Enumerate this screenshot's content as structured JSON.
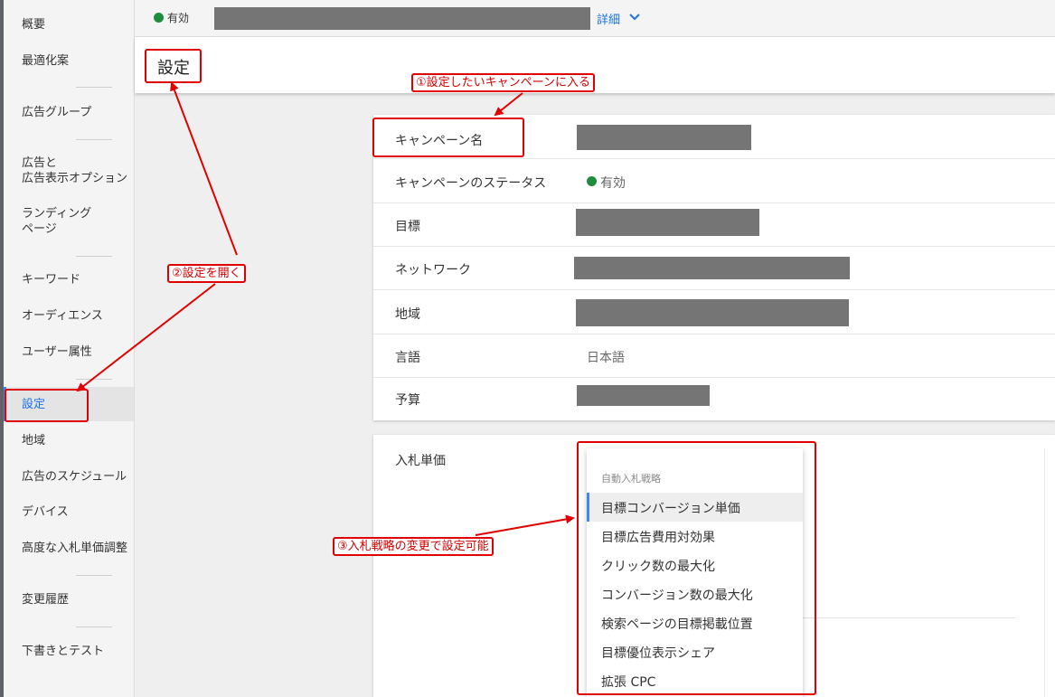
{
  "sidebar": {
    "items": [
      {
        "label": "概要"
      },
      {
        "label": "最適化案"
      },
      {
        "label": "広告グループ"
      },
      {
        "label": "広告と\n広告表示オプション"
      },
      {
        "label": "ランディング\nページ"
      },
      {
        "label": "キーワード"
      },
      {
        "label": "オーディエンス"
      },
      {
        "label": "ユーザー属性"
      },
      {
        "label": "設定"
      },
      {
        "label": "地域"
      },
      {
        "label": "広告のスケジュール"
      },
      {
        "label": "デバイス"
      },
      {
        "label": "高度な入札単価調整"
      },
      {
        "label": "変更履歴"
      },
      {
        "label": "下書きとテスト"
      }
    ],
    "active": "設定"
  },
  "topbar": {
    "status": "有効",
    "details": "詳細"
  },
  "page": {
    "title": "設定"
  },
  "campaign_settings": {
    "rows": [
      {
        "label": "キャンペーン名"
      },
      {
        "label": "キャンペーンのステータス",
        "value": "有効"
      },
      {
        "label": "目標"
      },
      {
        "label": "ネットワーク"
      },
      {
        "label": "地域"
      },
      {
        "label": "言語",
        "value": "日本語"
      },
      {
        "label": "予算"
      }
    ]
  },
  "bidding": {
    "label": "入札単価",
    "dropdown": {
      "header": "自動入札戦略",
      "options": [
        {
          "label": "目標コンバージョン単価",
          "selected": true
        },
        {
          "label": "目標広告費用対効果"
        },
        {
          "label": "クリック数の最大化"
        },
        {
          "label": "コンバージョン数の最大化"
        },
        {
          "label": "検索ページの目標掲載位置"
        },
        {
          "label": "目標優位表示シェア"
        },
        {
          "label": "拡張 CPC"
        }
      ]
    }
  },
  "annotations": {
    "step1": "①設定したいキャンペーンに入る",
    "step2": "②設定を開く",
    "step3": "③入札戦略の変更で設定可能",
    "color": "#e00000"
  },
  "colors": {
    "accent": "#4285f4",
    "status_green": "#1e8e3e",
    "redaction": "#757575"
  }
}
